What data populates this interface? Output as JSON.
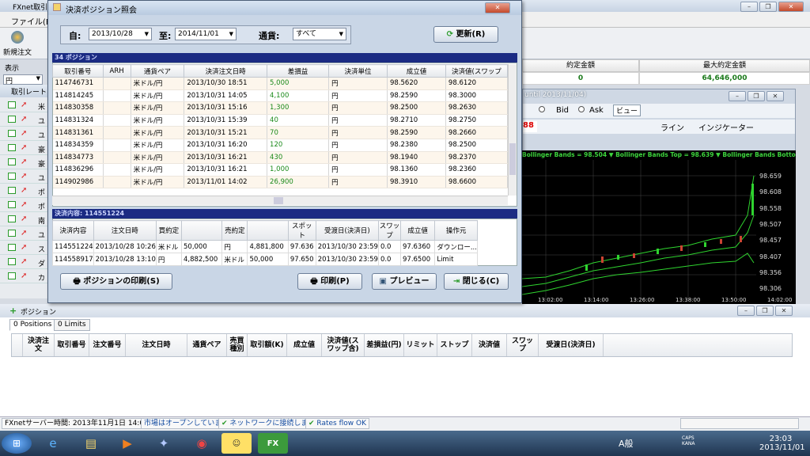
{
  "app": {
    "title": "FXnet取引",
    "menu": [
      "ファイル(F)"
    ],
    "toolbar_label": "新規注文",
    "view_label": "表示",
    "currency_select": "円",
    "rate_panel_title": "取引レート",
    "summary": {
      "headers": [
        "約定金額",
        "最大約定金額"
      ],
      "values": [
        "0",
        "64,646,000"
      ]
    },
    "left_items": [
      "米",
      "ユ",
      "ユ",
      "豪",
      "豪",
      "ユ",
      "ポ",
      "ポ",
      "南",
      "ユ",
      "ス",
      "ダ",
      "カ"
    ]
  },
  "chart_window": {
    "title": "until 2013/11/04)",
    "bid_label": "Bid",
    "ask_label": "Ask",
    "view_label": "ビュー",
    "line_label": "ライン",
    "indicator_label": "インジケーター",
    "red_value": "88",
    "legend": "Bollinger Bands = 98.504 ▼  Bollinger Bands Top = 98.639 ▼  Bollinger Bands Botto",
    "price_labels": [
      "98.659",
      "98.608",
      "98.558",
      "98.507",
      "98.457",
      "98.407",
      "98.356",
      "98.306"
    ],
    "time_labels": [
      "13:02:00",
      "13:14:00",
      "13:26:00",
      "13:38:00",
      "13:50:00",
      "14:02:00"
    ]
  },
  "dialog": {
    "title": "決済ポジション照会",
    "from_label": "自:",
    "from_value": "2013/10/28",
    "to_label": "至:",
    "to_value": "2014/11/01",
    "currency_label": "通貨:",
    "currency_value": "すべて",
    "refresh_button": "更新(R)",
    "positions_section": "34 ポジション",
    "positions_columns": [
      "取引番号",
      "ARH",
      "通貨ペア",
      "決済注文日時",
      "差損益",
      "決済単位",
      "成立値",
      "決済値(スワップ"
    ],
    "positions_rows": [
      [
        "114746731",
        "",
        "米ドル/円",
        "2013/10/30 18:51",
        "5,000",
        "円",
        "98.5620",
        "98.6120"
      ],
      [
        "114814245",
        "",
        "米ドル/円",
        "2013/10/31 14:05",
        "4,100",
        "円",
        "98.2590",
        "98.3000"
      ],
      [
        "114830358",
        "",
        "米ドル/円",
        "2013/10/31 15:16",
        "1,300",
        "円",
        "98.2500",
        "98.2630"
      ],
      [
        "114831324",
        "",
        "米ドル/円",
        "2013/10/31 15:39",
        "40",
        "円",
        "98.2710",
        "98.2750"
      ],
      [
        "114831361",
        "",
        "米ドル/円",
        "2013/10/31 15:21",
        "70",
        "円",
        "98.2590",
        "98.2660"
      ],
      [
        "114834359",
        "",
        "米ドル/円",
        "2013/10/31 16:20",
        "120",
        "円",
        "98.2380",
        "98.2500"
      ],
      [
        "114834773",
        "",
        "米ドル/円",
        "2013/10/31 16:21",
        "430",
        "円",
        "98.1940",
        "98.2370"
      ],
      [
        "114836296",
        "",
        "米ドル/円",
        "2013/10/31 16:21",
        "1,000",
        "円",
        "98.1360",
        "98.2360"
      ],
      [
        "114902986",
        "",
        "米ドル/円",
        "2013/11/01 14:02",
        "26,900",
        "円",
        "98.3910",
        "98.6600"
      ]
    ],
    "detail_section": "決済内容: 114551224",
    "detail_columns": [
      "決済内容",
      "注文日時",
      "買約定",
      "",
      "売約定",
      "",
      "スポット",
      "受渡日(決済日)",
      "スワップ",
      "成立値",
      "操作元"
    ],
    "detail_rows": [
      [
        "114551224",
        "2013/10/28 10:26",
        "米ドル",
        "50,000",
        "円",
        "4,881,800",
        "97.636",
        "2013/10/30 23:59",
        "0.0",
        "97.6360",
        "ダウンロー..."
      ],
      [
        "114558917",
        "2013/10/28 13:10",
        "円",
        "4,882,500",
        "米ドル",
        "50,000",
        "97.650",
        "2013/10/30 23:59",
        "0.0",
        "97.6500",
        "Limit"
      ]
    ],
    "print_positions_button": "ポジションの印刷(S)",
    "print_button": "印刷(P)",
    "preview_button": "プレビュー",
    "close_button": "閉じる(C)"
  },
  "positions_panel": {
    "title": "ポジション",
    "tabs": [
      "0 Positions",
      "0 Limits"
    ],
    "columns": [
      "決済注文",
      "取引番号",
      "注文番号",
      "注文日時",
      "通貨ペア",
      "売買種別",
      "取引額(K)",
      "成立値",
      "決済値(スワップ含)",
      "差損益(円)",
      "リミット",
      "ストップ",
      "決済値",
      "スワップ",
      "受渡日(決済日)"
    ]
  },
  "status": {
    "server_time": "FXnetサーバー時間: 2013年11月1日 14:02",
    "market": "市場はオープンしています",
    "network": "ネットワークに接続しました",
    "rates": "Rates flow OK"
  },
  "taskbar": {
    "ime": "A般",
    "caps": "CAPS",
    "kana": "KANA",
    "time": "23:03",
    "date": "2013/11/01"
  },
  "colors": {
    "accent": "#1b2b83",
    "profit": "#1b8a1b",
    "chart_bg": "#000000"
  }
}
